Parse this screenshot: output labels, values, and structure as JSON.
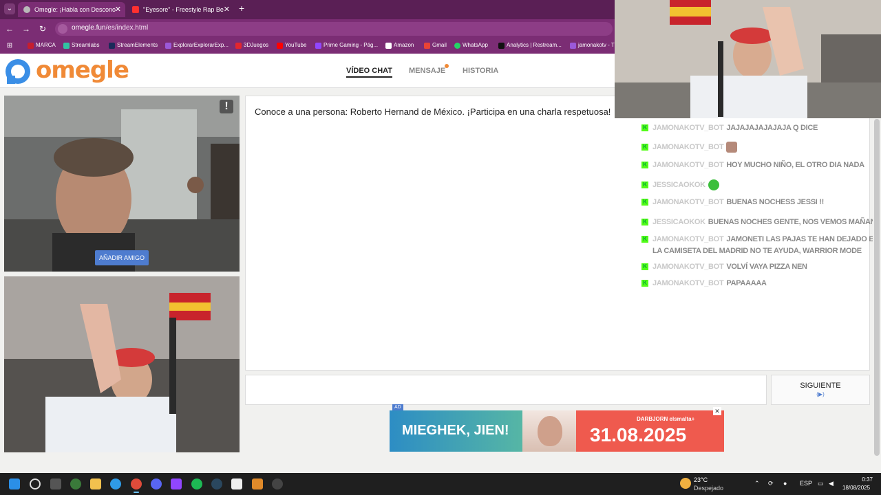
{
  "browser": {
    "tabs": [
      {
        "title": "Omegle: ¡Habla con Descono",
        "active": true
      },
      {
        "title": "\"Eyesore\" - Freestyle Rap Be",
        "active": false
      }
    ],
    "url_domain": "omegle.fun",
    "url_path": "/es/index.html",
    "bookmarks": [
      "MARCA",
      "Streamlabs",
      "StreamElements",
      "ExplorarExplorarExp...",
      "3DJuegos",
      "YouTube",
      "Prime Gaming - Pág...",
      "Amazon",
      "Gmail",
      "WhatsApp",
      "Analytics | Restream...",
      "jamonakotv - T"
    ]
  },
  "site": {
    "logo": "omegle",
    "nav": [
      "VÍDEO CHAT",
      "MENSAJE",
      "HISTORIA"
    ],
    "add_friend": "AÑADIR AMIGO",
    "report": "!",
    "chat_intro": "Conoce a una persona: Roberto Hernand de México. ¡Participa en una charla respetuosa!",
    "next_label": "SIGUIENTE",
    "next_arrow": "(▶)"
  },
  "ad": {
    "tag": "AD",
    "title": "MIEGHEK, JIEN!",
    "brand": "DARBJORN  elsmalta+",
    "date": "31.08.2025",
    "close": "✕"
  },
  "stream_chat": [
    {
      "user": "jamonakotv_bot",
      "msg": "JAJAJAJAJAJAJA Q DICE",
      "emote": null
    },
    {
      "user": "jamonakotv_bot",
      "msg": "",
      "emote": "photo-emote"
    },
    {
      "user": "jamonakotv_bot",
      "msg": "HOY MUCHO NIÑO, EL OTRO DIA NADA",
      "emote": null
    },
    {
      "user": "jessicaokok",
      "msg": "",
      "emote": "frog-emote"
    },
    {
      "user": "jamonakotv_bot",
      "msg": "BUENAS NOCHESS JESSI !!",
      "emote": null
    },
    {
      "user": "jessicaokok",
      "msg": "BUENAS NOCHES GENTE, NOS VEMOS MAÑANA!!",
      "emote": "pepe-emote"
    },
    {
      "user": "jamonakotv_bot",
      "msg": "JAMONETI LAS PAJAS TE HAN DEJADO EN LA MIERDA, Y",
      "msg2": "LA CAMISETA DEL MADRID NO TE AYUDA, WARRIOR MODE",
      "emote": null
    },
    {
      "user": "jamonakotv_bot",
      "msg": "VOLVÍ VAYA PIZZA NEN",
      "emote": null
    },
    {
      "user": "jamonakotv_bot",
      "msg": "PAPAAAAA",
      "emote": null
    }
  ],
  "taskbar": {
    "temp": "23°C",
    "weather": "Despejado",
    "lang": "ESP",
    "time": "0:37",
    "date": "18/08/2025"
  }
}
